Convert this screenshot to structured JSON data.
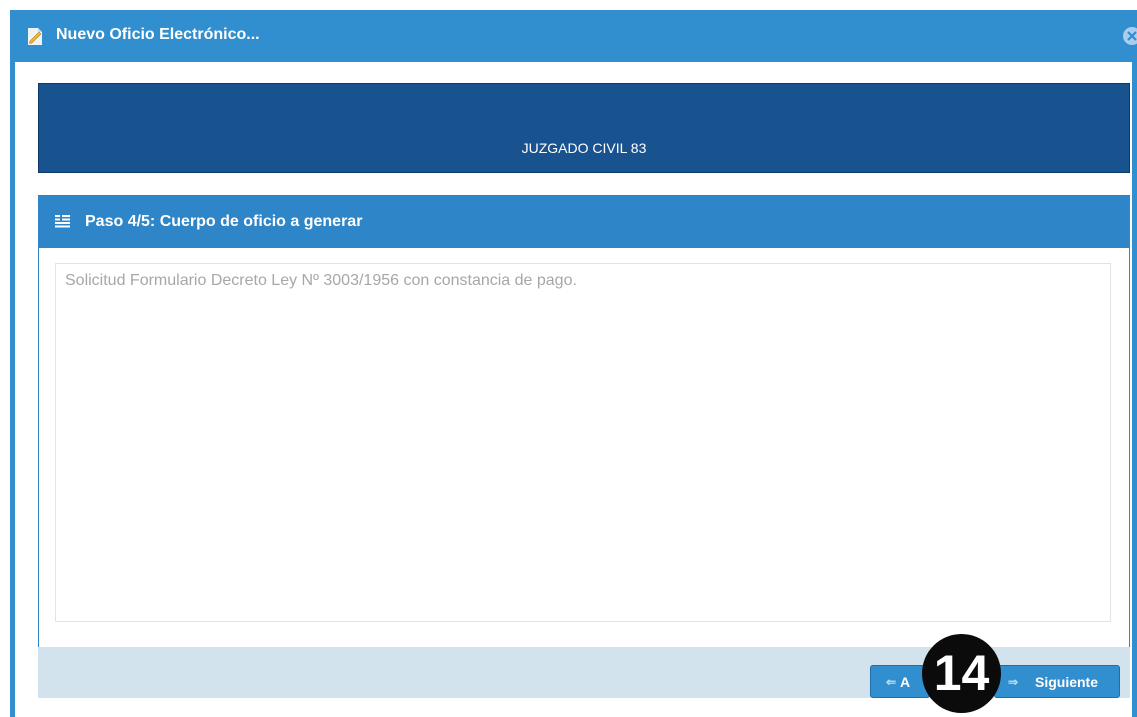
{
  "window": {
    "title": "Nuevo Oficio Electrónico...",
    "icon": "document-edit-icon",
    "close_icon": "close-circle-icon"
  },
  "court": {
    "name": "JUZGADO CIVIL 83"
  },
  "step": {
    "title": "Paso 4/5: Cuerpo de oficio a generar",
    "icon": "text-align-icon",
    "body_placeholder": "Solicitud Formulario Decreto Ley Nº 3003/1956 con constancia de pago."
  },
  "footer": {
    "back_label": "A",
    "next_label": "Siguiente",
    "back_icon": "arrow-left-icon",
    "next_icon": "arrow-right-icon"
  },
  "annotation": {
    "badge": "14"
  },
  "colors": {
    "title_bar": "#318ecf",
    "court_header": "#18528f",
    "step_header": "#2e86c8",
    "footer": "#d3e3ee",
    "badge": "#0b0b0b"
  }
}
